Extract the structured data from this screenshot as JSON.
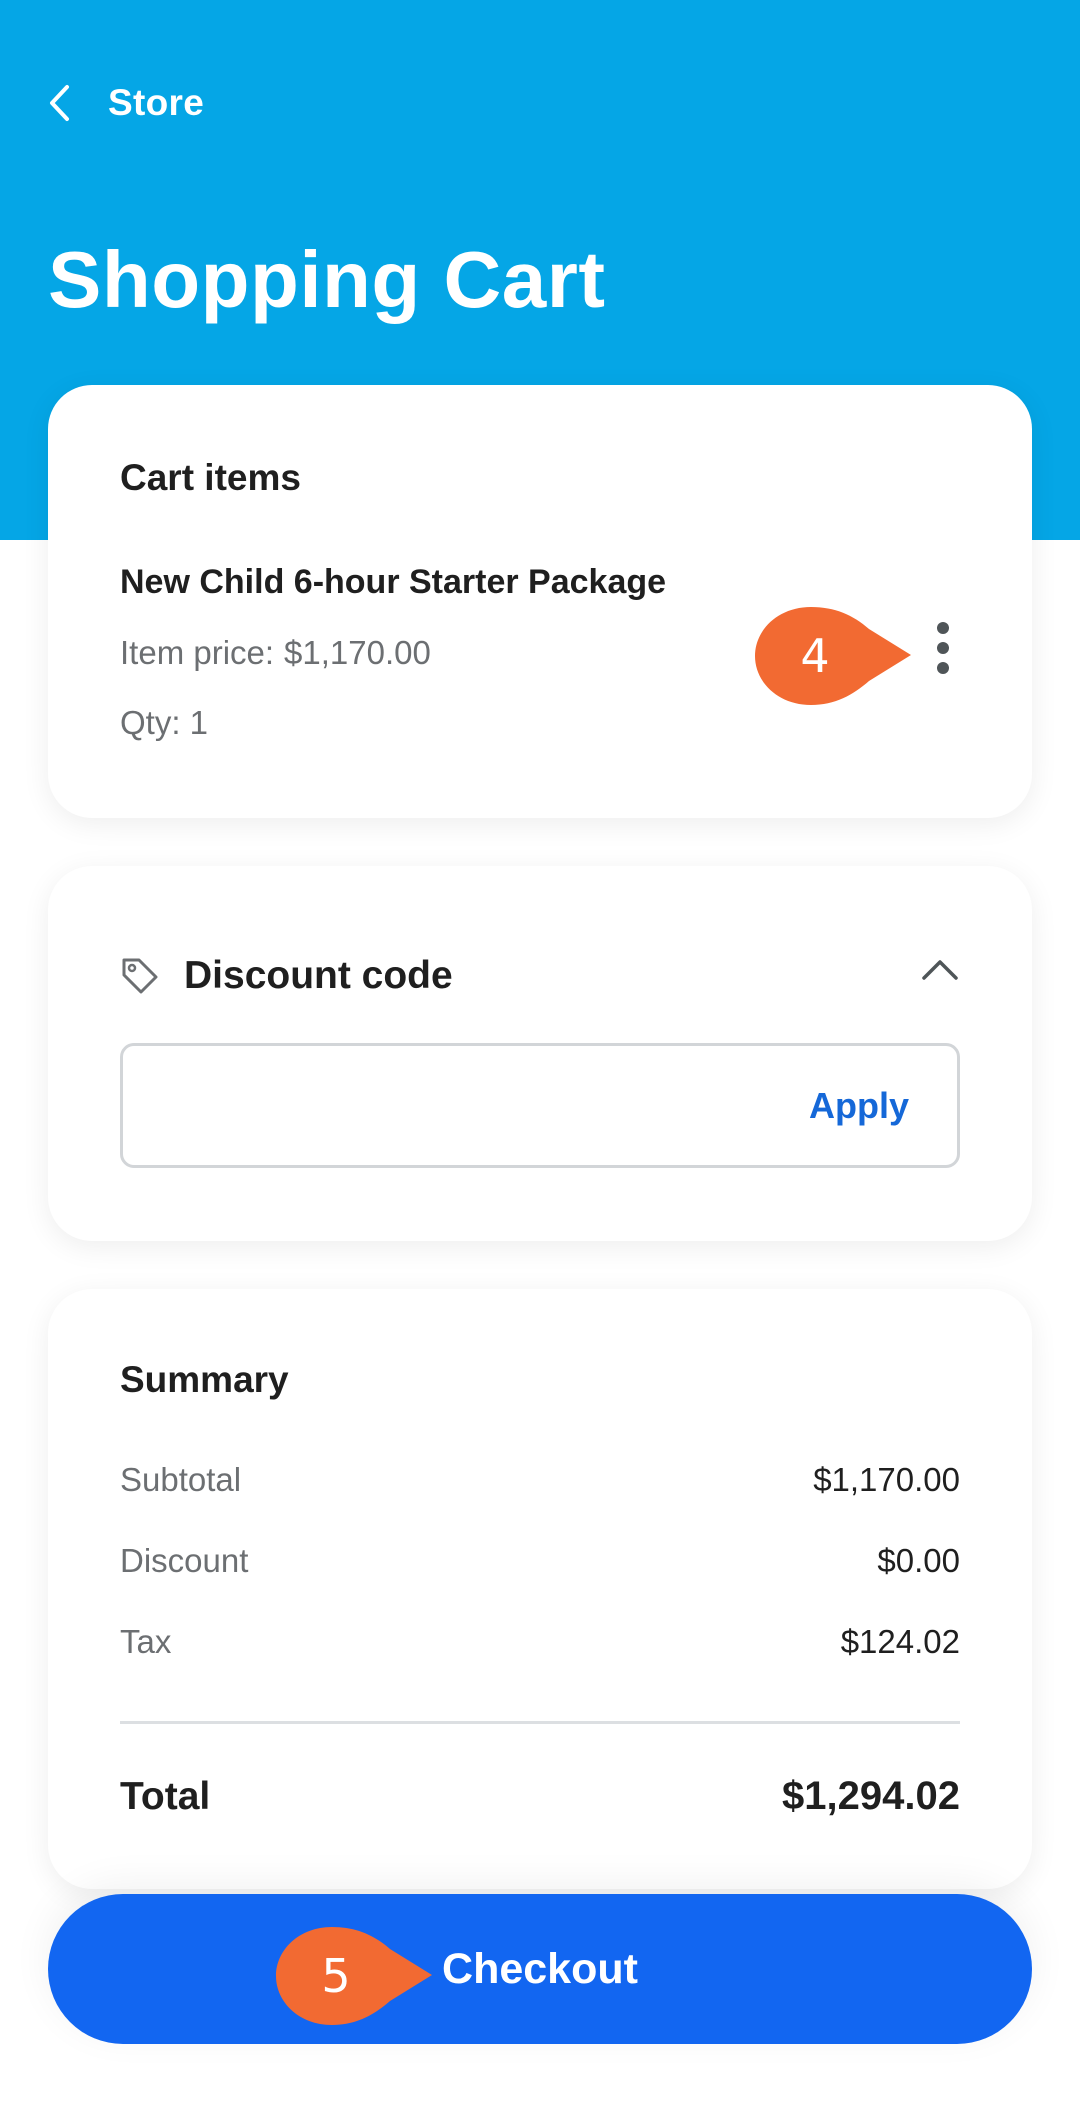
{
  "header": {
    "back_label": "Store",
    "title": "Shopping Cart",
    "background_color": "#05a6e6"
  },
  "cart": {
    "heading": "Cart items",
    "item": {
      "name": "New Child 6-hour Starter Package",
      "price_label": "Item price:",
      "price": "$1,170.00",
      "qty_label": "Qty: 1"
    },
    "menu_icon": "more-vertical-icon"
  },
  "discount": {
    "title": "Discount code",
    "icon": "tag-icon",
    "expanded": true,
    "input_value": "",
    "apply_label": "Apply",
    "accent_color": "#1568d8"
  },
  "summary": {
    "heading": "Summary",
    "rows": [
      {
        "label": "Subtotal",
        "value": "$1,170.00"
      },
      {
        "label": "Discount",
        "value": "$0.00"
      },
      {
        "label": "Tax",
        "value": "$124.02"
      }
    ],
    "total_label": "Total",
    "total_value": "$1,294.02"
  },
  "checkout": {
    "label": "Checkout",
    "color": "#1266f1"
  },
  "callouts": [
    {
      "number": "4",
      "color": "#f26a32"
    },
    {
      "number": "5",
      "color": "#f26a32"
    }
  ]
}
